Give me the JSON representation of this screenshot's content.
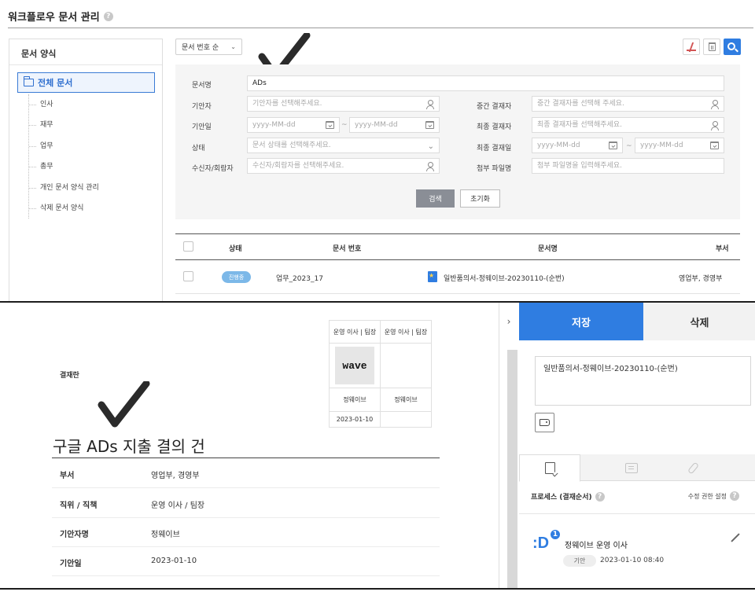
{
  "header": {
    "title": "워크플로우 문서 관리"
  },
  "tree": {
    "heading": "문서 양식",
    "root": "전체 문서",
    "children": [
      "인사",
      "재무",
      "업무",
      "총무",
      "개인 문서 양식 관리",
      "삭제 문서 양식"
    ]
  },
  "toolbar": {
    "sort": "문서 번호 순"
  },
  "filters": {
    "doc_name_label": "문서명",
    "doc_name_value": "ADs",
    "drafter_label": "기안자",
    "drafter_placeholder": "기안자를 선택해주세요.",
    "mid_approver_label": "중간 결재자",
    "mid_approver_placeholder": "중간 결재자를 선택해 주세요.",
    "draft_date_label": "기안일",
    "final_approver_label": "최종 결재자",
    "final_approver_placeholder": "최종 결재자를 선택해주세요.",
    "status_label": "상태",
    "status_placeholder": "문서 상태를 선택해주세요.",
    "final_date_label": "최종 결재일",
    "recipient_label": "수신자/회람자",
    "recipient_placeholder": "수신자/회람자를 선택해주세요.",
    "attach_label": "첨부 파일명",
    "attach_placeholder": "첨부 파일명을 입력해주세요.",
    "date_placeholder": "yyyy-MM-dd",
    "range_sep": "~",
    "search_label": "검색",
    "reset_label": "초기화"
  },
  "table": {
    "columns": [
      "상태",
      "문서 번호",
      "문서명",
      "부서"
    ],
    "rows": [
      {
        "status": "진행중",
        "number": "업무_2023_17",
        "name": "일반품의서-정웨이브-20230110-(순번)",
        "dept": "영업부, 경영부"
      }
    ]
  },
  "approval": {
    "section_label": "결재란",
    "columns": [
      "운영 이사 | 팀장",
      "운영 이사 | 팀장"
    ],
    "stamp_text": "wave",
    "names": [
      "정웨이브",
      "정웨이브"
    ],
    "dates": [
      "2023-01-10",
      ""
    ]
  },
  "document": {
    "title": "구글 ADs 지출 결의 건",
    "fields": [
      {
        "key": "부서",
        "value": "영업부, 경영부"
      },
      {
        "key": "직위 / 직책",
        "value": "운영 이사 / 팀장"
      },
      {
        "key": "기안자명",
        "value": "정웨이브"
      },
      {
        "key": "기안일",
        "value": "2023-01-10"
      }
    ]
  },
  "sidebar": {
    "collapse": "›",
    "save_label": "저장",
    "delete_label": "삭제",
    "memo": "일반품의서-정웨이브-20230110-(순번)",
    "process_title": "프로세스 (결재순서)",
    "permission_label": "수정 권한 설정",
    "approver": {
      "logo": ":D",
      "order": "1",
      "name": "정웨이브 운영 이사",
      "kind": "기안",
      "time": "2023-01-10 08:40"
    }
  },
  "colors": {
    "accent": "#2f7de1",
    "status_pill": "#7cb8e8"
  }
}
